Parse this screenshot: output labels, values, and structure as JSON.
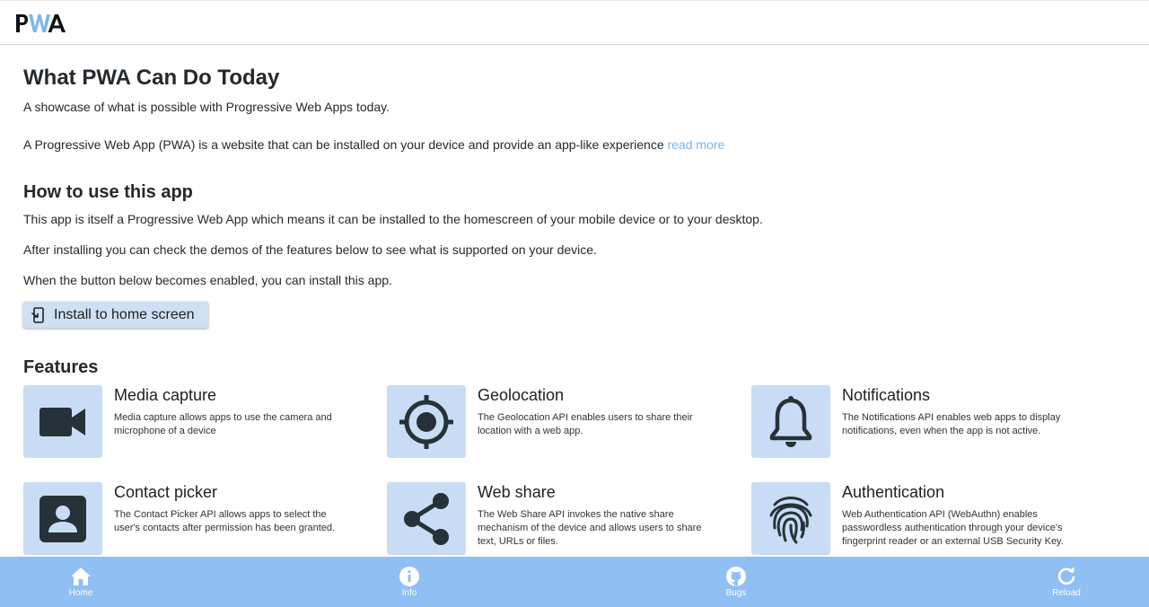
{
  "header": {
    "logo_text": "PWA"
  },
  "main": {
    "title": "What PWA Can Do Today",
    "subtitle": "A showcase of what is possible with Progressive Web Apps today.",
    "intro_text": "A Progressive Web App (PWA) is a website that can be installed on your device and provide an app-like experience",
    "read_more_label": "read more",
    "howto_heading": "How to use this app",
    "howto_p1": "This app is itself a Progressive Web App which means it can be installed to the homescreen of your mobile device or to your desktop.",
    "howto_p2": "After installing you can check the demos of the features below to see what is supported on your device.",
    "howto_p3": "When the button below becomes enabled, you can install this app.",
    "install_label": "Install to home screen",
    "features_heading": "Features"
  },
  "features": [
    {
      "title": "Media capture",
      "description": "Media capture allows apps to use the camera and microphone of a device",
      "icon": "video-camera-icon"
    },
    {
      "title": "Geolocation",
      "description": "The Geolocation API enables users to share their location with a web app.",
      "icon": "location-target-icon"
    },
    {
      "title": "Notifications",
      "description": "The Notifications API enables web apps to display notifications, even when the app is not active.",
      "icon": "bell-icon"
    },
    {
      "title": "Contact picker",
      "description": "The Contact Picker API allows apps to select the user's contacts after permission has been granted.",
      "icon": "contact-card-icon"
    },
    {
      "title": "Web share",
      "description": "The Web Share API invokes the native share mechanism of the device and allows users to share text, URLs or files.",
      "icon": "share-icon"
    },
    {
      "title": "Authentication",
      "description": "Web Authentication API (WebAuthn) enables passwordless authentication through your device's fingerprint reader or an external USB Security Key.",
      "icon": "fingerprint-icon"
    }
  ],
  "bottom_nav": [
    {
      "label": "Home",
      "icon": "home-icon"
    },
    {
      "label": "Info",
      "icon": "info-icon"
    },
    {
      "label": "Bugs",
      "icon": "github-icon"
    },
    {
      "label": "Reload",
      "icon": "reload-icon"
    }
  ],
  "colors": {
    "accent_link": "#78b4e8",
    "tile_background": "#c9dcf5",
    "bottom_nav_background": "#8fbff3",
    "install_button_background": "#cfe0f5"
  }
}
